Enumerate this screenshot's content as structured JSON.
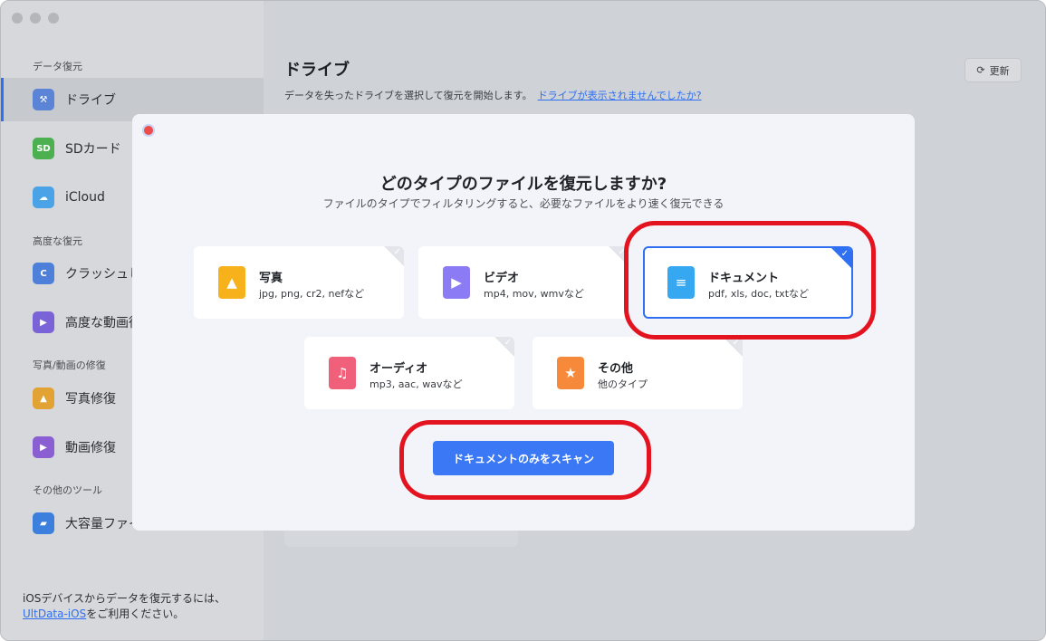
{
  "sidebar": {
    "sections": [
      {
        "label": "データ復元"
      },
      {
        "label": "高度な復元"
      },
      {
        "label": "写真/動画の修復"
      },
      {
        "label": "その他のツール"
      }
    ],
    "items": [
      {
        "label": "ドライブ",
        "icon": "drive-icon"
      },
      {
        "label": "SDカード",
        "icon": "sd-card-icon"
      },
      {
        "label": "iCloud",
        "icon": "icloud-icon"
      },
      {
        "label": "クラッシュし",
        "icon": "crash-icon"
      },
      {
        "label": "高度な動画復",
        "icon": "video-recovery-icon"
      },
      {
        "label": "写真修復",
        "icon": "photo-repair-icon"
      },
      {
        "label": "動画修復",
        "icon": "video-repair-icon"
      },
      {
        "label": "大容量ファイ",
        "icon": "large-file-icon"
      }
    ],
    "footer_text": "iOSデバイスからデータを復元するには、",
    "footer_link": "UltData-iOS",
    "footer_suffix": "をご利用ください。"
  },
  "header": {
    "title": "ドライブ",
    "subtitle": "データを失ったドライブを選択して復元を開始します。",
    "help_link": "ドライブが表示されませんでしたか?",
    "refresh_label": "更新"
  },
  "modal": {
    "title": "どのタイプのファイルを復元しますか?",
    "subtitle": "ファイルのタイプでフィルタリングすると、必要なファイルをより速く復元できる",
    "types": [
      {
        "name": "写真",
        "desc": "jpg, png, cr2, nefなど",
        "color": "#f7b21b",
        "selected": false
      },
      {
        "name": "ビデオ",
        "desc": "mp4, mov, wmvなど",
        "color": "#8b7cf6",
        "selected": false
      },
      {
        "name": "ドキュメント",
        "desc": "pdf, xls, doc, txtなど",
        "color": "#35a8f1",
        "selected": true
      },
      {
        "name": "オーディオ",
        "desc": "mp3, aac, wavなど",
        "color": "#f0607a",
        "selected": false
      },
      {
        "name": "その他",
        "desc": "他のタイプ",
        "color": "#f78a3a",
        "selected": false
      }
    ],
    "scan_button": "ドキュメントのみをスキャン"
  },
  "colors": {
    "accent": "#2f6ff2",
    "annotation": "#e3131f"
  }
}
